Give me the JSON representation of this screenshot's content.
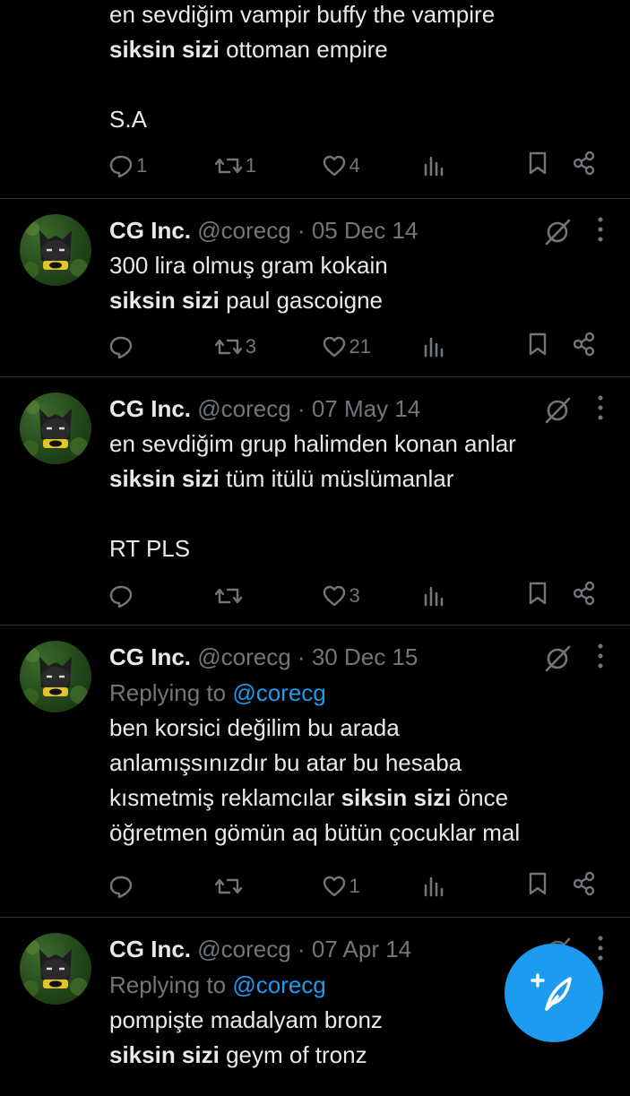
{
  "colors": {
    "background": "#000000",
    "text": "#e7e9ea",
    "muted": "#71767b",
    "accent": "#1d9bf0",
    "divider": "#2f3336"
  },
  "tweets": [
    {
      "partial": true,
      "lines": [
        {
          "segments": [
            {
              "text": "en sevdiğim vampir buffy the vampire",
              "bold": false
            }
          ]
        },
        {
          "segments": [
            {
              "text": "siksin sizi",
              "bold": true
            },
            {
              "text": " ottoman empire",
              "bold": false
            }
          ]
        },
        {
          "segments": []
        },
        {
          "segments": [
            {
              "text": "S.A",
              "bold": false
            }
          ]
        }
      ],
      "actions": {
        "replies": "1",
        "retweets": "1",
        "likes": "4"
      }
    },
    {
      "name": "CG Inc.",
      "handle": "@corecg",
      "date": "05 Dec 14",
      "lines": [
        {
          "segments": [
            {
              "text": "300 lira olmuş gram kokain",
              "bold": false
            }
          ]
        },
        {
          "segments": [
            {
              "text": "siksin sizi",
              "bold": true
            },
            {
              "text": " paul gascoigne",
              "bold": false
            }
          ]
        }
      ],
      "actions": {
        "replies": "",
        "retweets": "3",
        "likes": "21"
      }
    },
    {
      "name": "CG Inc.",
      "handle": "@corecg",
      "date": "07 May 14",
      "lines": [
        {
          "segments": [
            {
              "text": "en sevdiğim grup halimden konan anlar",
              "bold": false
            }
          ]
        },
        {
          "segments": [
            {
              "text": "siksin sizi",
              "bold": true
            },
            {
              "text": " tüm itülü müslümanlar",
              "bold": false
            }
          ]
        },
        {
          "segments": []
        },
        {
          "segments": [
            {
              "text": "RT PLS",
              "bold": false
            }
          ]
        }
      ],
      "actions": {
        "replies": "",
        "retweets": "",
        "likes": "3"
      }
    },
    {
      "name": "CG Inc.",
      "handle": "@corecg",
      "date": "30 Dec 15",
      "replying_prefix": "Replying to ",
      "replying_to": "@corecg",
      "lines": [
        {
          "segments": [
            {
              "text": "ben korsici değilim bu arada",
              "bold": false
            }
          ]
        },
        {
          "segments": [
            {
              "text": "anlamışsınızdır bu atar bu hesaba",
              "bold": false
            }
          ]
        },
        {
          "segments": [
            {
              "text": "kısmetmiş reklamcılar ",
              "bold": false
            },
            {
              "text": "siksin sizi",
              "bold": true
            },
            {
              "text": " önce",
              "bold": false
            }
          ]
        },
        {
          "segments": [
            {
              "text": "öğretmen gömün aq bütün çocuklar mal",
              "bold": false
            }
          ]
        }
      ],
      "actions": {
        "replies": "",
        "retweets": "",
        "likes": "1"
      }
    },
    {
      "partial_bottom": true,
      "name": "CG Inc.",
      "handle": "@corecg",
      "date": "07 Apr 14",
      "replying_prefix": "Replying to ",
      "replying_to": "@corecg",
      "lines": [
        {
          "segments": [
            {
              "text": "pompişte madalyam bronz",
              "bold": false
            }
          ]
        },
        {
          "segments": [
            {
              "text": "siksin sizi",
              "bold": true
            },
            {
              "text": " geym of tronz",
              "bold": false
            }
          ]
        }
      ]
    }
  ],
  "icons": {
    "reply": "reply-icon",
    "retweet": "retweet-icon",
    "like": "heart-icon",
    "views": "views-icon",
    "bookmark": "bookmark-icon",
    "share": "share-icon",
    "grok": "grok-icon",
    "more": "more-icon",
    "compose": "compose-icon"
  }
}
